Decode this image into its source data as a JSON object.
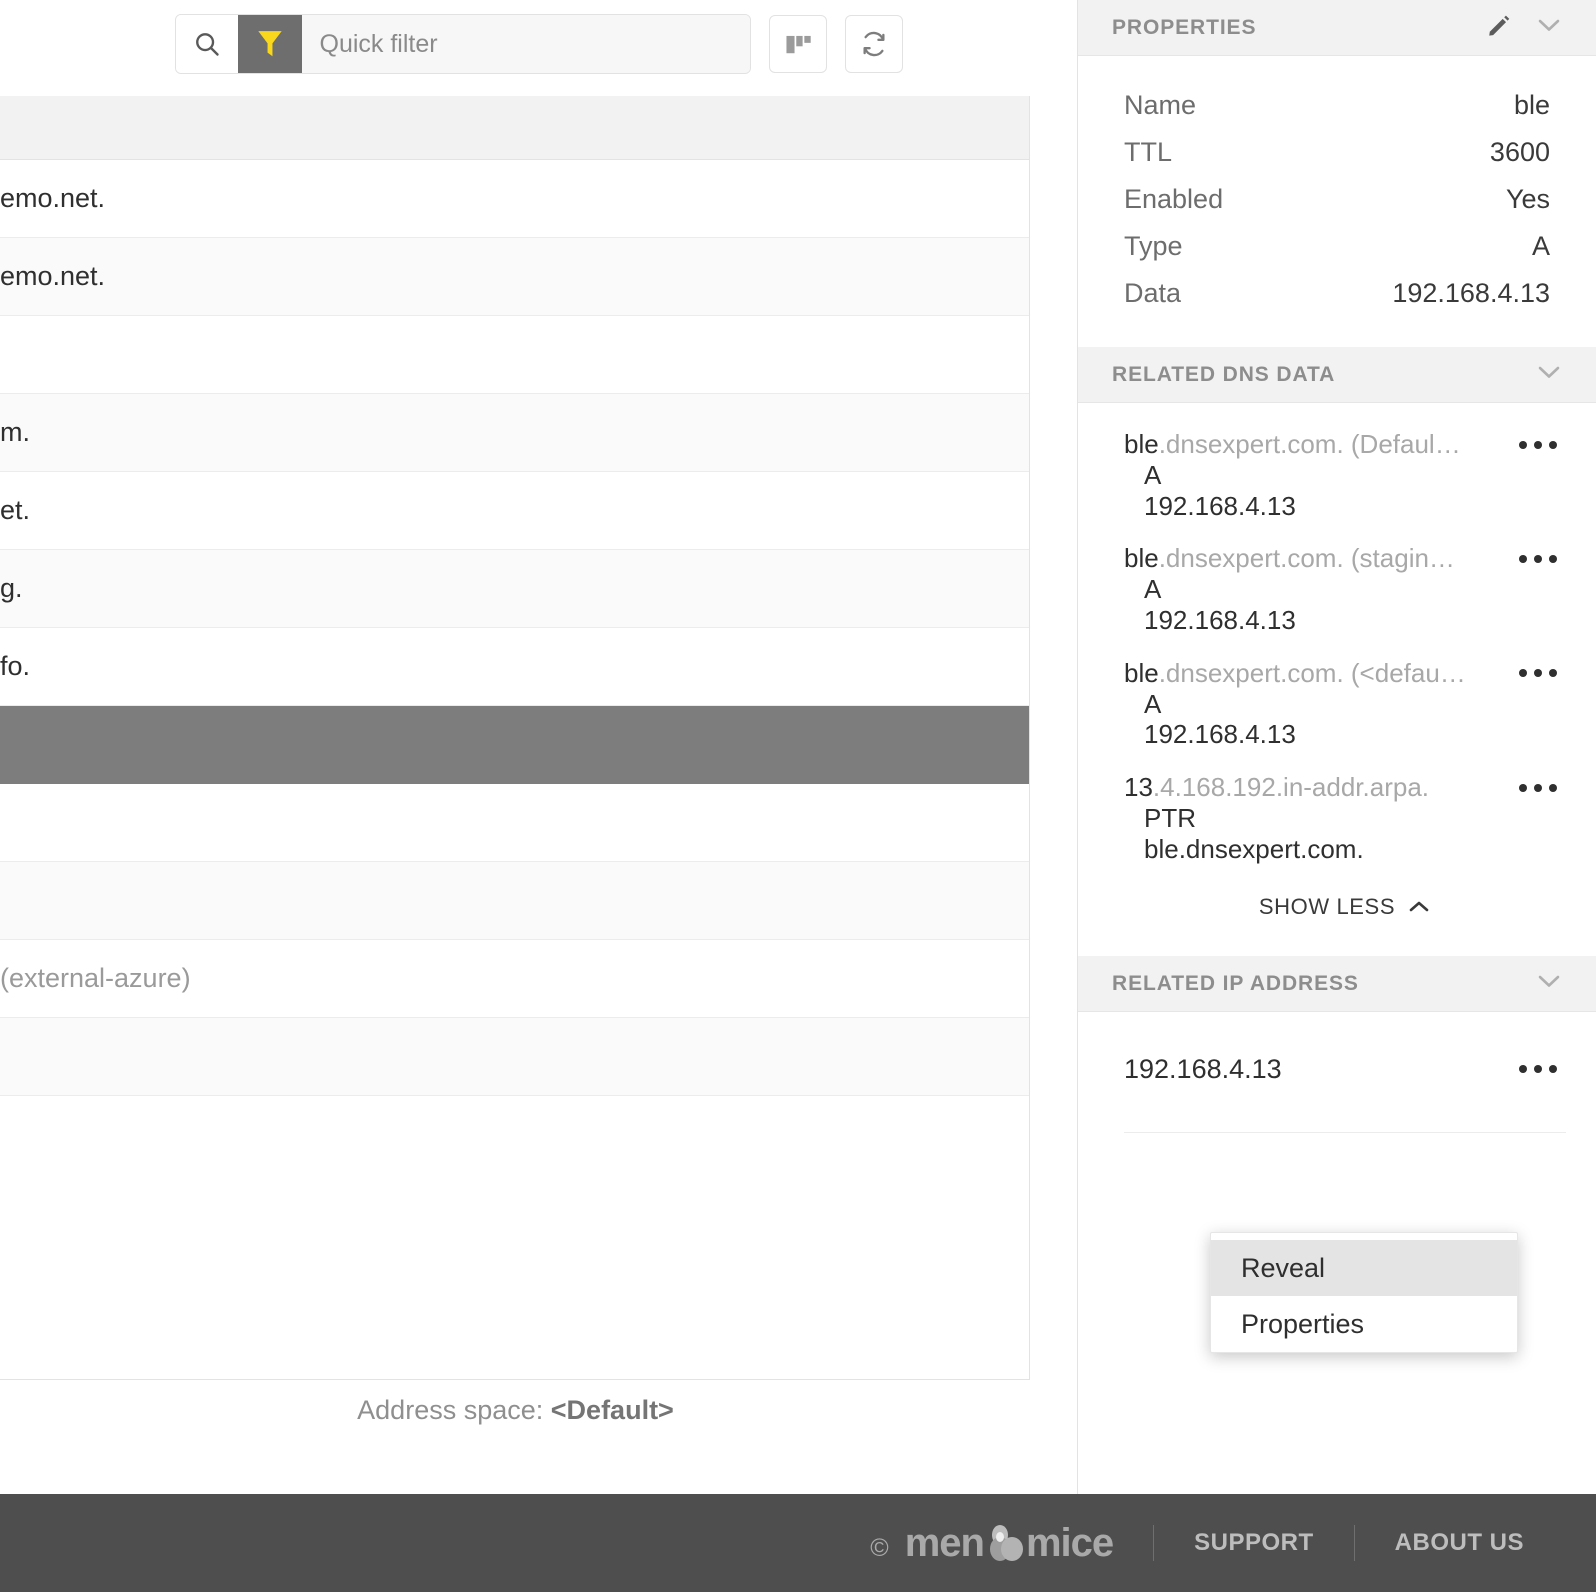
{
  "toolbar": {
    "search_icon": "search-icon",
    "filter_icon": "funnel-icon",
    "quick_filter_placeholder": "Quick filter",
    "quick_filter_value": "",
    "columns_icon": "columns-icon",
    "refresh_icon": "refresh-icon"
  },
  "table": {
    "rows": [
      {
        "text": "emo.net.",
        "muted": "",
        "style": "plain"
      },
      {
        "text": "emo.net.",
        "muted": "",
        "style": "alt"
      },
      {
        "text": "",
        "muted": "",
        "style": "plain"
      },
      {
        "text": "m.",
        "muted": "",
        "style": "alt"
      },
      {
        "text": "et.",
        "muted": "",
        "style": "plain"
      },
      {
        "text": "g.",
        "muted": "",
        "style": "alt"
      },
      {
        "text": "fo.",
        "muted": "",
        "style": "plain"
      },
      {
        "text": "",
        "muted": "",
        "style": "selected"
      },
      {
        "text": "",
        "muted": "",
        "style": "plain"
      },
      {
        "text": "",
        "muted": "",
        "style": "alt"
      },
      {
        "text": "",
        "muted": "(external-azure)",
        "style": "plain"
      },
      {
        "text": "",
        "muted": "",
        "style": "alt"
      }
    ]
  },
  "address_space": {
    "label": "Address space:",
    "value": "<Default>"
  },
  "properties": {
    "title": "PROPERTIES",
    "edit_icon": "pencil-icon",
    "collapse_icon": "chevron-down-icon",
    "rows": [
      {
        "key": "Name",
        "value": "ble"
      },
      {
        "key": "TTL",
        "value": "3600"
      },
      {
        "key": "Enabled",
        "value": "Yes"
      },
      {
        "key": "Type",
        "value": "A"
      },
      {
        "key": "Data",
        "value": "192.168.4.13"
      }
    ]
  },
  "related_dns": {
    "title": "RELATED DNS DATA",
    "collapse_icon": "chevron-down-icon",
    "items": [
      {
        "bold": "ble",
        "rest": ".dnsexpert.com. (Defaul…",
        "type": "A",
        "data": "192.168.4.13",
        "menu_icon": "kebab-menu-icon"
      },
      {
        "bold": "ble",
        "rest": ".dnsexpert.com. (stagin…",
        "type": "A",
        "data": "192.168.4.13",
        "menu_icon": "kebab-menu-icon"
      },
      {
        "bold": "ble",
        "rest": ".dnsexpert.com. (<defau…",
        "type": "A",
        "data": "192.168.4.13",
        "menu_icon": "kebab-menu-icon"
      },
      {
        "bold": "13",
        "rest": ".4.168.192.in-addr.arpa.",
        "type": "PTR",
        "data": "ble.dnsexpert.com.",
        "menu_icon": "kebab-menu-icon"
      }
    ],
    "show_less_label": "SHOW LESS",
    "show_less_icon": "chevron-up-icon"
  },
  "related_ip": {
    "title": "RELATED IP ADDRESS",
    "collapse_icon": "chevron-down-icon",
    "value": "192.168.4.13",
    "menu_icon": "kebab-menu-icon"
  },
  "context_menu": {
    "items": [
      {
        "label": "Reveal",
        "highlighted": true
      },
      {
        "label": "Properties",
        "highlighted": false
      }
    ]
  },
  "footer": {
    "copyright": "©",
    "brand_part1": "men",
    "brand_part2": "mice",
    "support_label": "SUPPORT",
    "about_label": "ABOUT US"
  },
  "colors": {
    "filter_accent": "#F9D71C",
    "filter_bg": "#6e6e6e",
    "selected_row": "#7d7d7d",
    "footer_bg": "#4e4e4e",
    "section_header_bg": "#f2f2f2"
  }
}
